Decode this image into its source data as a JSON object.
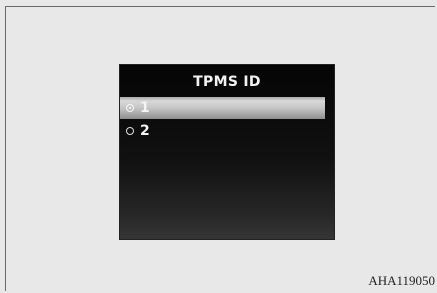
{
  "screen": {
    "title": "TPMS ID",
    "options": [
      {
        "label": "1",
        "selected": true,
        "highlighted": true
      },
      {
        "label": "2",
        "selected": false,
        "highlighted": false
      }
    ]
  },
  "figure_code": "AHA119050"
}
